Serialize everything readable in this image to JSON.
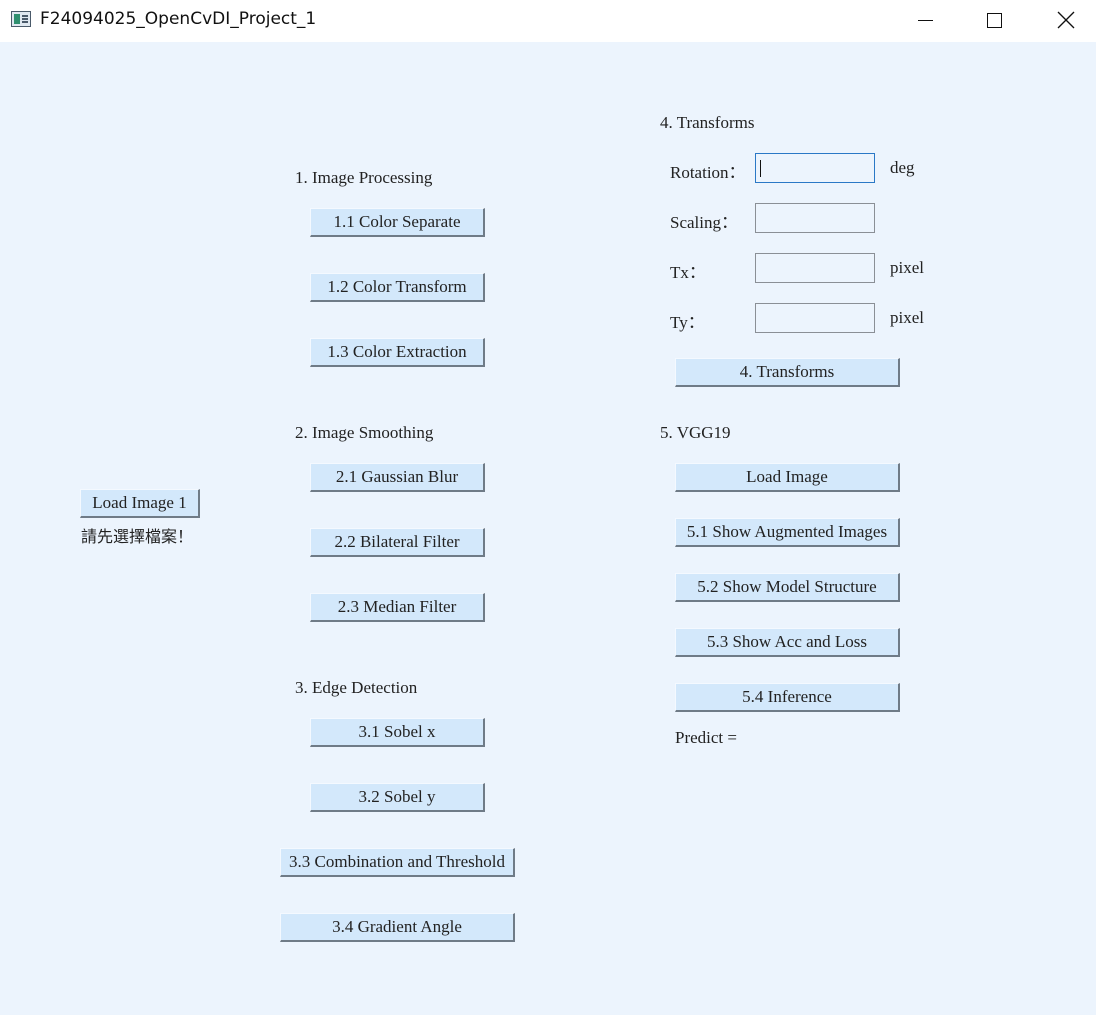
{
  "window": {
    "title": "F24094025_OpenCvDI_Project_1"
  },
  "left": {
    "load_image_1_label": "Load Image 1",
    "status_text": "請先選擇檔案！"
  },
  "section1": {
    "heading": "1. Image Processing",
    "buttons": [
      "1.1 Color Separate",
      "1.2 Color Transform",
      "1.3 Color Extraction"
    ]
  },
  "section2": {
    "heading": "2. Image Smoothing",
    "buttons": [
      "2.1 Gaussian Blur",
      "2.2 Bilateral Filter",
      "2.3 Median Filter"
    ]
  },
  "section3": {
    "heading": "3. Edge Detection",
    "buttons": [
      "3.1 Sobel x",
      "3.2 Sobel y",
      "3.3 Combination and Threshold",
      "3.4 Gradient Angle"
    ]
  },
  "section4": {
    "heading": "4. Transforms",
    "rotation_label": "Rotation：",
    "rotation_value": "",
    "rotation_unit": "deg",
    "scaling_label": "Scaling：",
    "scaling_value": "",
    "tx_label": "Tx：",
    "tx_value": "",
    "tx_unit": "pixel",
    "ty_label": "Ty：",
    "ty_value": "",
    "ty_unit": "pixel",
    "button": "4. Transforms"
  },
  "section5": {
    "heading": "5. VGG19",
    "buttons": [
      "Load Image",
      "5.1 Show Augmented Images",
      "5.2 Show Model Structure",
      "5.3 Show Acc and Loss",
      "5.4 Inference"
    ],
    "predict_label": "Predict ="
  }
}
